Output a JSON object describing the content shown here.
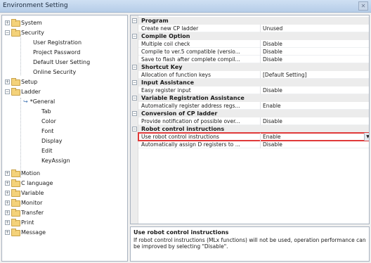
{
  "window": {
    "title": "Environment Setting",
    "close_glyph": "✕"
  },
  "tree": {
    "system": "System",
    "security": "Security",
    "user_registration": "User Registration",
    "project_password": "Project Password",
    "default_user_setting": "Default User Setting",
    "online_security": "Online Security",
    "setup": "Setup",
    "ladder": "Ladder",
    "general": "*General",
    "tab": "Tab",
    "color": "Color",
    "font": "Font",
    "display": "Display",
    "edit": "Edit",
    "keyassign": "KeyAssign",
    "motion": "Motion",
    "c_language": "C language",
    "variable": "Variable",
    "monitor": "Monitor",
    "transfer": "Transfer",
    "print": "Print",
    "message": "Message"
  },
  "grid": {
    "cat_program": "Program",
    "p_create_new_cp": "Create new CP ladder",
    "v_create_new_cp": "Unused",
    "cat_compile": "Compile Option",
    "p_multiple_coil": "Multiple coil check",
    "v_multiple_coil": "Disable",
    "p_compile_ver5": "Compile to ver.5 compatible (versio...",
    "v_compile_ver5": "Disable",
    "p_save_flash": "Save to flash after complete compil...",
    "v_save_flash": "Disable",
    "cat_shortcut": "Shortcut Key",
    "p_alloc_fn": "Allocation of function keys",
    "v_alloc_fn": "[Default Setting]",
    "cat_input": "Input Assistance",
    "p_easy_register": "Easy register input",
    "v_easy_register": "Disable",
    "cat_varreg": "Variable Registration Assistance",
    "p_auto_register": "Automatically register address regs...",
    "v_auto_register": "Enable",
    "cat_conversion": "Conversion of CP ladder",
    "p_provide_notif": "Provide notification of possible over...",
    "v_provide_notif": "Disable",
    "cat_robot": "Robot control instructions",
    "p_use_robot": "Use robot control instructions",
    "v_use_robot": "Enable",
    "p_auto_assign": "Automatically assign D registers to ...",
    "v_auto_assign": "Disable",
    "dropdown_glyph": "▼"
  },
  "description": {
    "title": "Use robot control instructions",
    "text": "If robot control instructions (MLx functions) will not be used, operation performance can be improved by selecting \"Disable\"."
  },
  "icons": {
    "expand_plus": "+",
    "collapse_minus": "−",
    "selected_arrow": "↪"
  },
  "colors": {
    "highlight_border": "#e03a3a",
    "folder": "#f4d27a",
    "titlebar": "#b6cde8"
  }
}
